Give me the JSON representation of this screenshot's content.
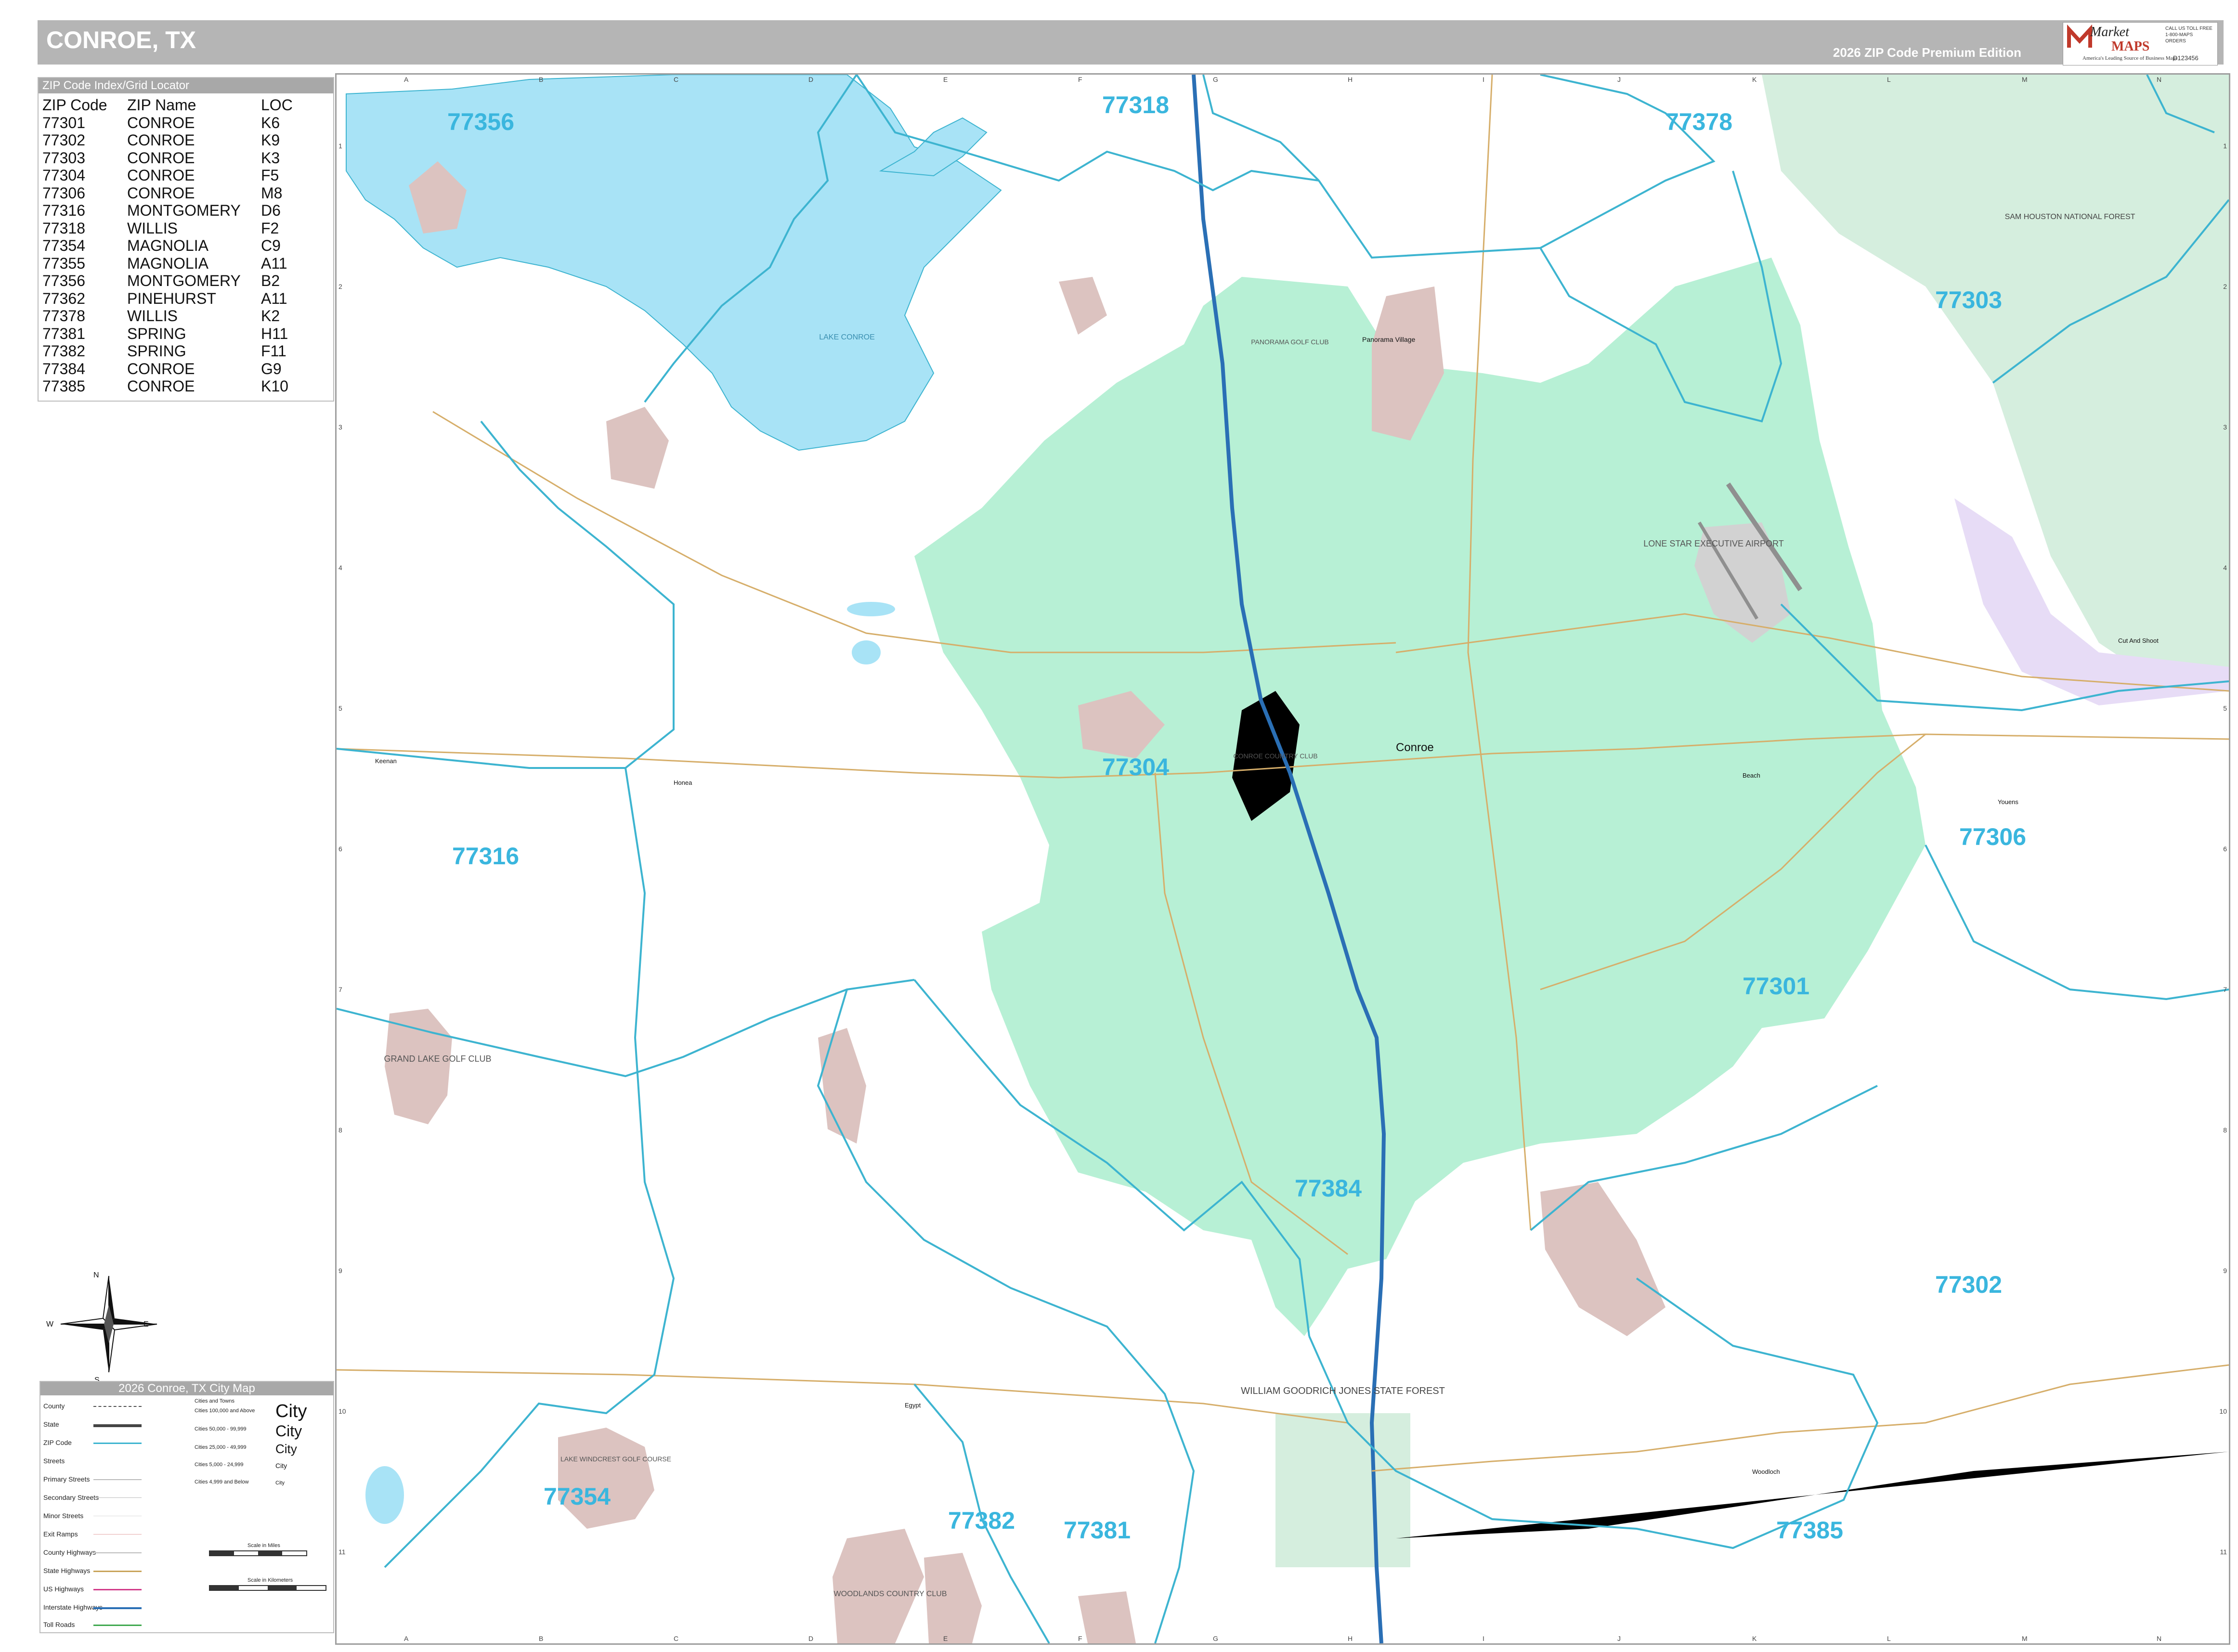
{
  "header": {
    "title": "CONROE, TX",
    "edition": "2026 ZIP Code Premium Edition",
    "logo_line1": "Market",
    "logo_line2": "MAPS",
    "logo_tagline": "America's Leading Source of Business Maps",
    "logo_phone": "CALL US TOLL FREE 1-800-MAPS ORDERS",
    "logo_code": "D123456"
  },
  "zip_index": {
    "title": "ZIP Code Index/Grid Locator",
    "columns": [
      "ZIP Code",
      "ZIP Name",
      "LOC"
    ],
    "rows": [
      [
        "77301",
        "CONROE",
        "K6"
      ],
      [
        "77302",
        "CONROE",
        "K9"
      ],
      [
        "77303",
        "CONROE",
        "K3"
      ],
      [
        "77304",
        "CONROE",
        "F5"
      ],
      [
        "77306",
        "CONROE",
        "M8"
      ],
      [
        "77316",
        "MONTGOMERY",
        "D6"
      ],
      [
        "77318",
        "WILLIS",
        "F2"
      ],
      [
        "77354",
        "MAGNOLIA",
        "C9"
      ],
      [
        "77355",
        "MAGNOLIA",
        "A11"
      ],
      [
        "77356",
        "MONTGOMERY",
        "B2"
      ],
      [
        "77362",
        "PINEHURST",
        "A11"
      ],
      [
        "77378",
        "WILLIS",
        "K2"
      ],
      [
        "77381",
        "SPRING",
        "H11"
      ],
      [
        "77382",
        "SPRING",
        "F11"
      ],
      [
        "77384",
        "CONROE",
        "G9"
      ],
      [
        "77385",
        "CONROE",
        "K10"
      ]
    ]
  },
  "grid": {
    "cols": [
      "A",
      "B",
      "C",
      "D",
      "E",
      "F",
      "G",
      "H",
      "I",
      "J",
      "K",
      "L",
      "M",
      "N"
    ],
    "rows": [
      "1",
      "2",
      "3",
      "4",
      "5",
      "6",
      "7",
      "8",
      "9",
      "10",
      "11"
    ]
  },
  "zip_labels": [
    "77356",
    "77318",
    "77378",
    "77303",
    "77304",
    "77316",
    "77306",
    "77301",
    "77384",
    "77302",
    "77354",
    "77382",
    "77381",
    "77385"
  ],
  "place_labels": {
    "conroe": "Conroe",
    "lake_conroe": "LAKE CONROE",
    "airport": "LONE STAR EXECUTIVE AIRPORT",
    "sam_houston": "SAM HOUSTON NATIONAL FOREST",
    "wgj_forest": "WILLIAM GOODRICH JONES STATE FOREST",
    "grand_lake": "GRAND LAKE GOLF CLUB",
    "lake_windcrest": "LAKE WINDCREST GOLF COURSE",
    "conroe_cc": "CONROE COUNTRY CLUB",
    "panorama": "PANORAMA GOLF CLUB",
    "panorama_village": "Panorama Village",
    "woodlands_cc": "WOODLANDS COUNTRY CLUB",
    "keenan": "Keenan",
    "honea": "Honea",
    "beach": "Beach",
    "youens": "Youens",
    "egypt": "Egypt",
    "woodloch": "Woodloch",
    "cut_and_shoot": "Cut And Shoot"
  },
  "compass": {
    "n": "N",
    "s": "S",
    "e": "E",
    "w": "W"
  },
  "legend": {
    "title": "2026 Conroe, TX City Map",
    "items": [
      "County",
      "State",
      "ZIP Code",
      "Streets",
      "Primary Streets",
      "Secondary Streets",
      "Minor Streets",
      "Exit Ramps",
      "County Highways",
      "State Highways",
      "US Highways",
      "Interstate Highways",
      "Toll Roads"
    ],
    "cities_header": "Cities and Towns",
    "city_sizes": [
      "Cities 100,000 and Above",
      "Cities 50,000 - 99,999",
      "Cities 25,000 - 49,999",
      "Cities 5,000 - 24,999",
      "Cities 4,999 and Below"
    ],
    "city_word": "City",
    "scale_miles": "Scale in Miles",
    "scale_km": "Scale in Kilometers"
  },
  "colors": {
    "water": "#a8e3f6",
    "zip_line": "#3db4d0",
    "conroe_fill": "#b7f0d5",
    "forest": "#d5eede",
    "golf": "#dcc3c0",
    "airport": "#d2d2d2",
    "cut_shoot": "#e7dcf6",
    "interstate": "#2a6fb5",
    "zip_label": "#3ab6de"
  }
}
